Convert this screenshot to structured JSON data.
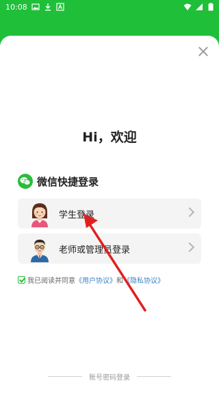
{
  "status_bar": {
    "time": "10:08",
    "icons": [
      "image-icon",
      "download-icon",
      "a-icon",
      "wifi-icon",
      "signal-icon",
      "battery-icon"
    ]
  },
  "colors": {
    "brand_green": "#1fbf3a",
    "link_blue": "#3b82c4"
  },
  "welcome_text": "Hi，欢迎",
  "wechat": {
    "title": "微信快捷登录"
  },
  "login_options": [
    {
      "label": "学生登录",
      "icon": "student-avatar"
    },
    {
      "label": "老师或管理员登录",
      "icon": "teacher-avatar"
    }
  ],
  "agreement": {
    "prefix": "我已阅读并同意",
    "user_agreement": "《用户协议》",
    "and": "和",
    "privacy_policy": "《隐私协议》",
    "checked": true
  },
  "account_login": "账号密码登录"
}
